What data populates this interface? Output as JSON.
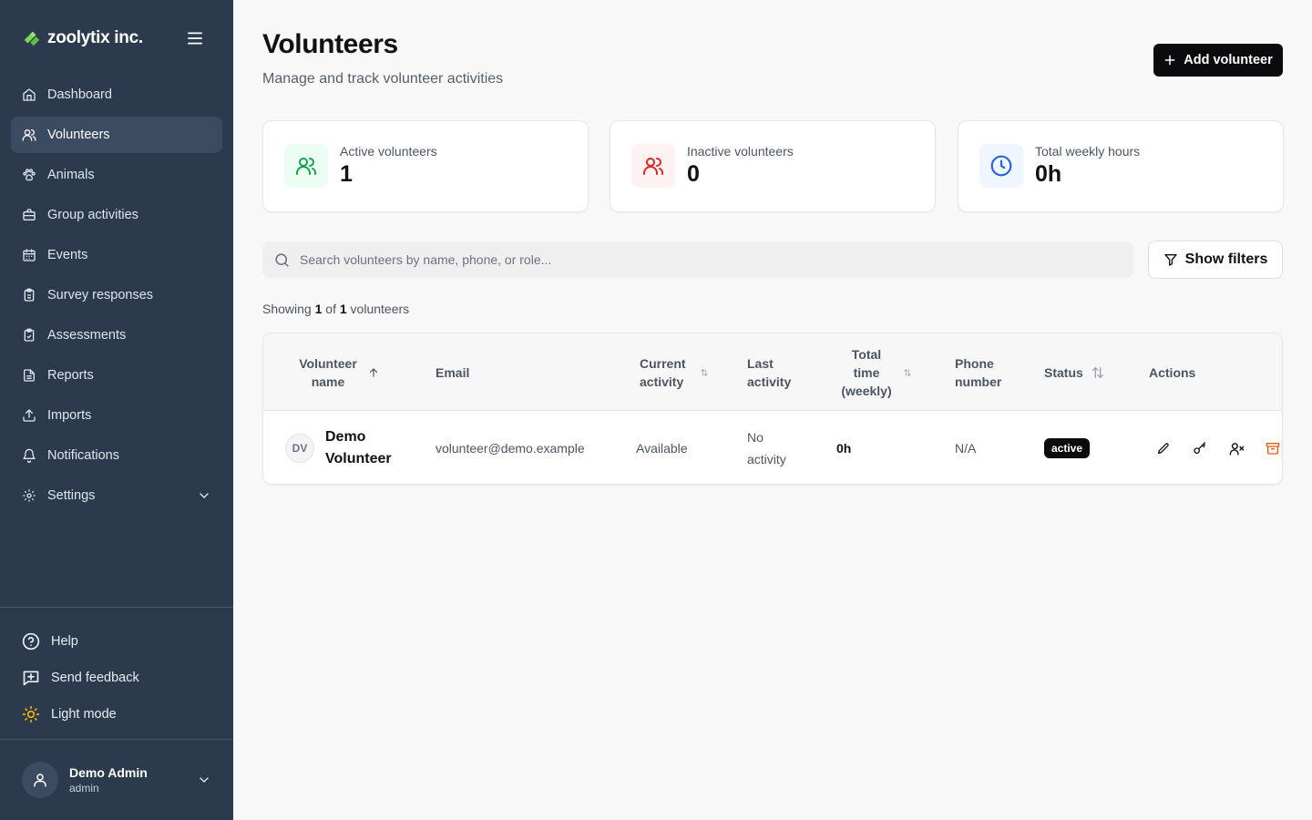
{
  "brand": {
    "name": "zoolytix inc."
  },
  "nav": [
    {
      "label": "Dashboard",
      "icon": "home-icon"
    },
    {
      "label": "Volunteers",
      "icon": "users-icon",
      "active": true
    },
    {
      "label": "Animals",
      "icon": "paw-icon"
    },
    {
      "label": "Group activities",
      "icon": "briefcase-icon"
    },
    {
      "label": "Events",
      "icon": "calendar-icon"
    },
    {
      "label": "Survey responses",
      "icon": "clipboard-icon"
    },
    {
      "label": "Assessments",
      "icon": "clipboard-check-icon"
    },
    {
      "label": "Reports",
      "icon": "file-icon"
    },
    {
      "label": "Imports",
      "icon": "upload-icon"
    },
    {
      "label": "Notifications",
      "icon": "bell-icon"
    },
    {
      "label": "Settings",
      "icon": "gear-icon"
    }
  ],
  "sidebar_bottom": {
    "help": "Help",
    "feedback": "Send feedback",
    "theme": "Light mode"
  },
  "user": {
    "name": "Demo Admin",
    "role": "admin"
  },
  "header": {
    "title": "Volunteers",
    "subtitle": "Manage and track volunteer activities",
    "add_button": "Add volunteer"
  },
  "stats": [
    {
      "label": "Active volunteers",
      "value": "1",
      "color": "#16a34a",
      "bg": "#ecfdf3"
    },
    {
      "label": "Inactive volunteers",
      "value": "0",
      "color": "#dc2626",
      "bg": "#fef2f2"
    },
    {
      "label": "Total weekly hours",
      "value": "0h",
      "color": "#2563eb",
      "bg": "#eff6ff"
    }
  ],
  "search": {
    "placeholder": "Search volunteers by name, phone, or role..."
  },
  "filters_button": "Show filters",
  "showing": {
    "prefix": "Showing",
    "shown": "1",
    "of": "of",
    "total": "1",
    "suffix": "volunteers"
  },
  "table": {
    "columns": {
      "name": "Volunteer name",
      "email": "Email",
      "current_activity": "Current activity",
      "last_activity": "Last activity",
      "total_time": "Total time (weekly)",
      "phone": "Phone number",
      "status": "Status",
      "actions": "Actions"
    },
    "rows": [
      {
        "initials": "DV",
        "name": "Demo Volunteer",
        "email": "volunteer@demo.example",
        "current_activity": "Available",
        "last_activity": "No activity",
        "total_time": "0h",
        "phone": "N/A",
        "status": "active"
      }
    ]
  },
  "colors": {
    "sidebar": "#2b3a4c",
    "sidebar_active": "#3b4c61",
    "primary": "#0b0b0d",
    "archive": "#ea580c"
  }
}
